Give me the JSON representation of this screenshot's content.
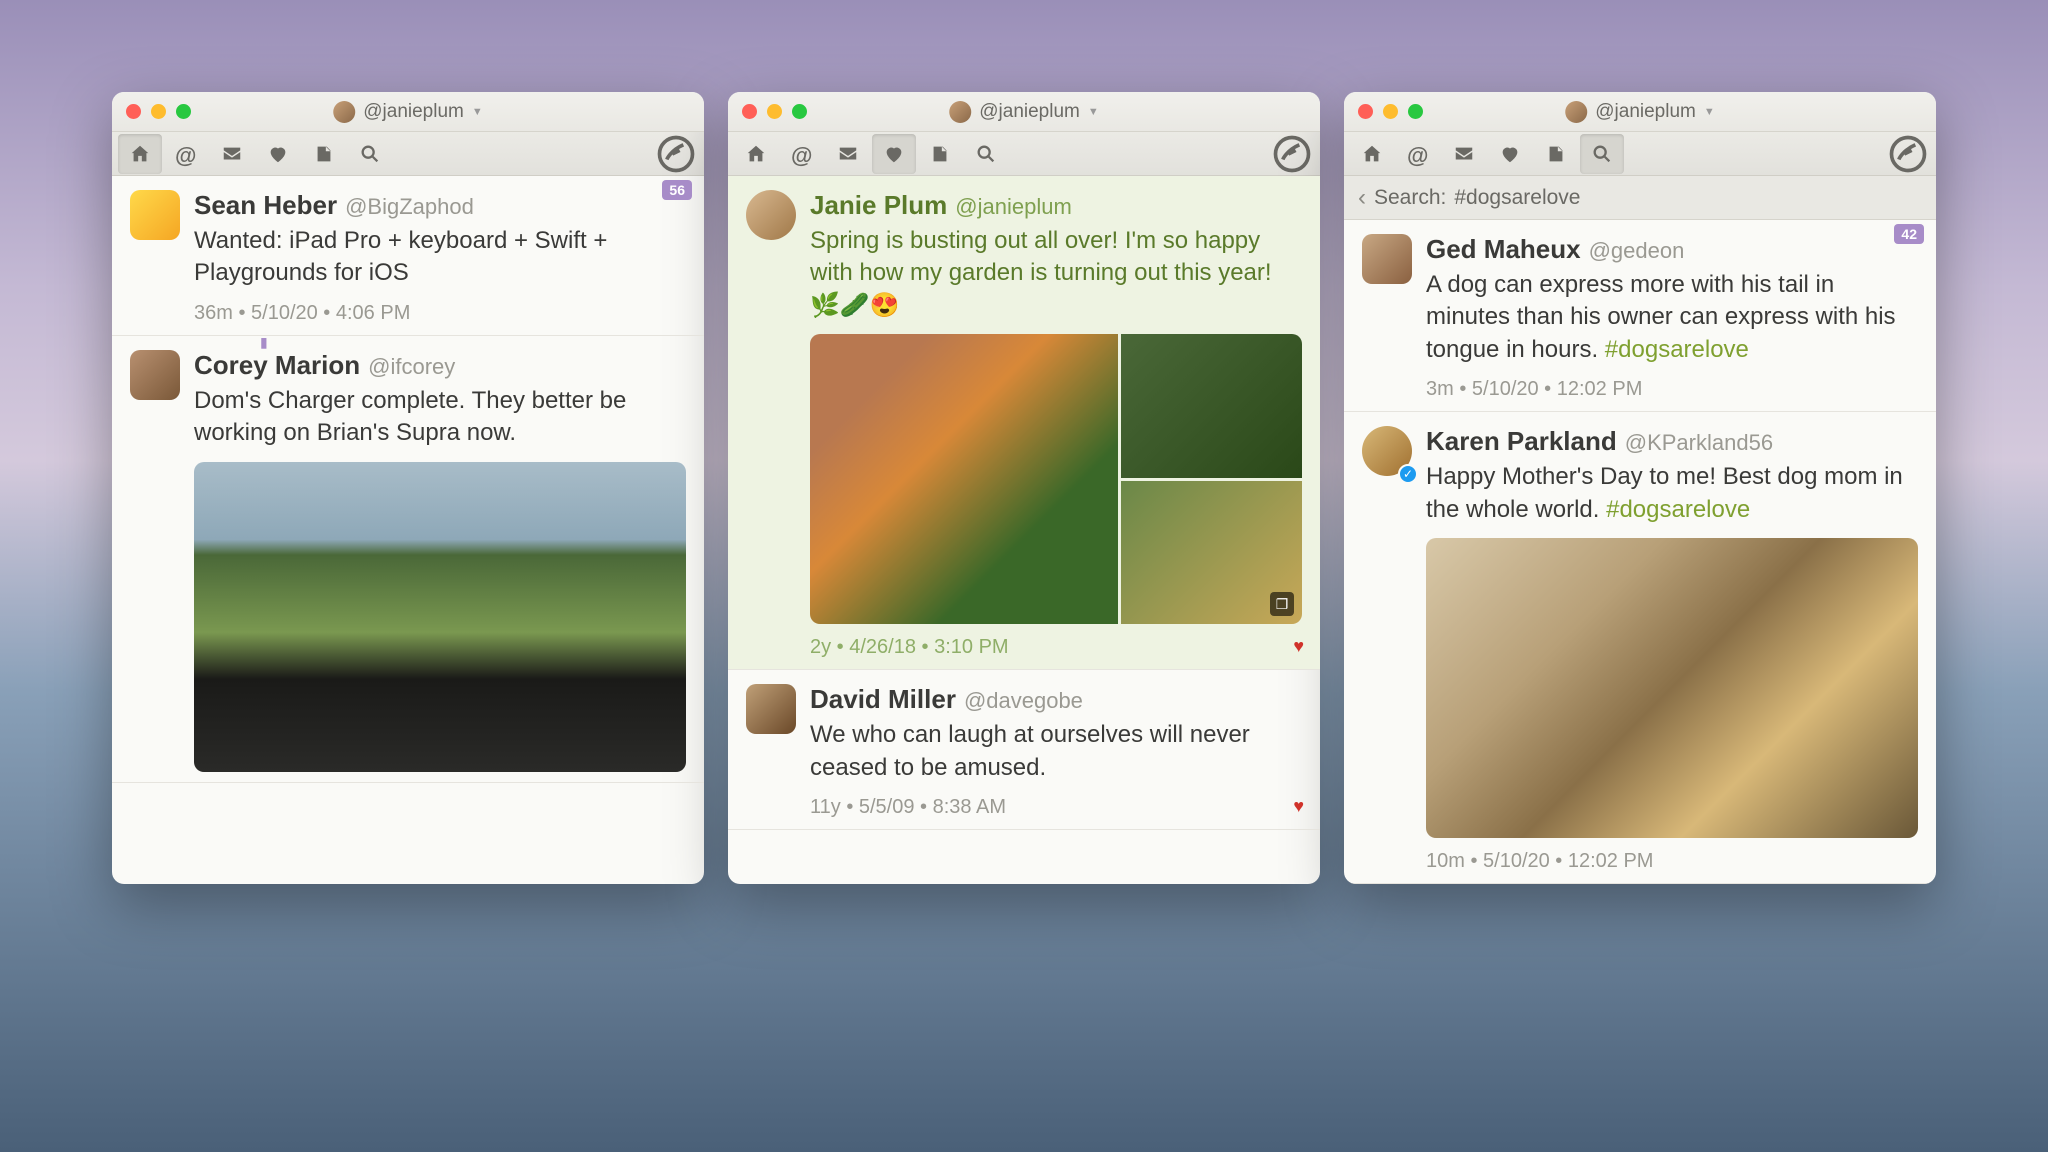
{
  "account_handle": "@janieplum",
  "windows": [
    {
      "badge": "56",
      "active_tab": "home",
      "tweets": [
        {
          "avatar_class": "av-bigzaphod",
          "display": "Sean Heber",
          "handle": "@BigZaphod",
          "body": "Wanted: iPad Pro + keyboard + Swift + Playgrounds for iOS",
          "meta": "36m • 5/10/20 • 4:06 PM"
        },
        {
          "avatar_class": "av-corey",
          "display": "Corey Marion",
          "handle": "@ifcorey",
          "body": "Dom's Charger complete. They better be working on Brian's Supra now.",
          "meta": "",
          "has_bookmark": true,
          "media": "car"
        }
      ]
    },
    {
      "active_tab": "likes",
      "tweets": [
        {
          "highlight": true,
          "avatar_round": true,
          "avatar_class": "av-janie",
          "display": "Janie Plum",
          "handle": "@janieplum",
          "body": "Spring is busting out all over! I'm so happy with how my garden is turning out this year! 🌿🥒😍",
          "meta": "2y • 4/26/18 • 3:10 PM",
          "media": "garden",
          "liked": true
        },
        {
          "avatar_class": "av-david",
          "display": "David Miller",
          "handle": "@davegobe",
          "body": "We who can laugh at ourselves will never ceased to be amused.",
          "meta": "11y • 5/5/09 • 8:38 AM",
          "liked": true
        }
      ]
    },
    {
      "badge": "42",
      "active_tab": "search",
      "search_label": "Search:",
      "search_query": "#dogsarelove",
      "tweets": [
        {
          "avatar_class": "av-ged",
          "display": "Ged Maheux",
          "handle": "@gedeon",
          "body_pre": "A dog can express more with his tail in minutes than his owner can express with his tongue in hours. ",
          "hashtag": "#dogsarelove",
          "meta": "3m • 5/10/20 • 12:02 PM"
        },
        {
          "avatar_round": true,
          "avatar_class": "av-karen",
          "verified": true,
          "display": "Karen Parkland",
          "handle": "@KParkland56",
          "body_pre": "Happy Mother's Day to me! Best dog mom in the whole world.  ",
          "hashtag": "#dogsarelove",
          "meta": "10m • 5/10/20 • 12:02 PM",
          "media": "dog"
        }
      ]
    }
  ]
}
